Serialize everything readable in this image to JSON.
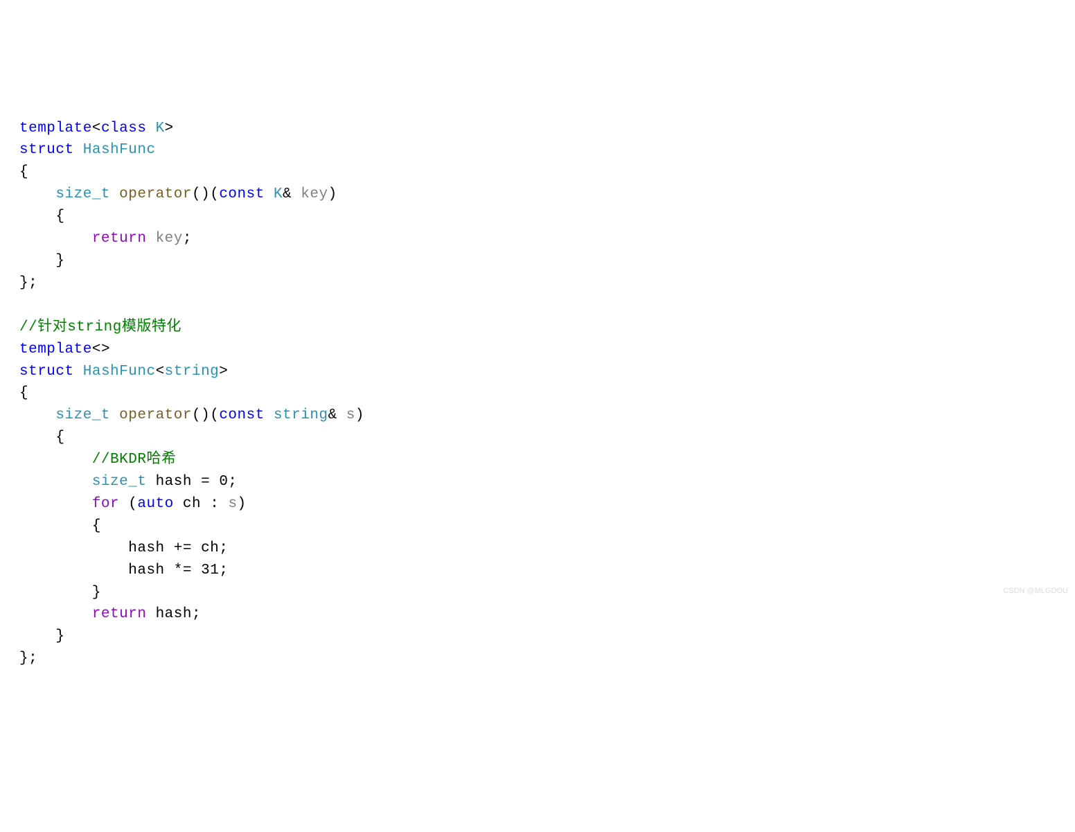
{
  "code": {
    "l1": {
      "template": "template",
      "lt": "<",
      "class_kw": "class",
      "sp": " ",
      "K": "K",
      "gt": ">"
    },
    "l2": {
      "struct": "struct",
      "sp": " ",
      "HashFunc": "HashFunc"
    },
    "l3": {
      "brace": "{"
    },
    "l4": {
      "size_t": "size_t",
      "sp": " ",
      "operator": "operator",
      "parens": "()",
      "open": "(",
      "const": "const",
      "sp2": " ",
      "K": "K",
      "amp": "&",
      "sp3": " ",
      "key": "key",
      "close": ")"
    },
    "l5": {
      "brace": "{"
    },
    "l6": {
      "return": "return",
      "sp": " ",
      "key": "key",
      "semi": ";"
    },
    "l7": {
      "brace": "}"
    },
    "l8": {
      "brace": "};"
    },
    "l9": {
      "blank": ""
    },
    "l10": {
      "cmt": "//针对string模版特化"
    },
    "l11": {
      "template": "template",
      "lt": "<",
      "gt": ">"
    },
    "l12": {
      "struct": "struct",
      "sp": " ",
      "HashFunc": "HashFunc",
      "lt": "<",
      "string": "string",
      "gt": ">"
    },
    "l13": {
      "brace": "{"
    },
    "l14": {
      "size_t": "size_t",
      "sp": " ",
      "operator": "operator",
      "parens": "()",
      "open": "(",
      "const": "const",
      "sp2": " ",
      "string": "string",
      "amp": "&",
      "sp3": " ",
      "s": "s",
      "close": ")"
    },
    "l15": {
      "brace": "{"
    },
    "l16": {
      "cmt": "//BKDR哈希"
    },
    "l17": {
      "size_t": "size_t",
      "sp": " ",
      "hash": "hash",
      "sp2": " ",
      "eq": "=",
      "sp3": " ",
      "zero": "0",
      "semi": ";"
    },
    "l18": {
      "for": "for",
      "sp": " ",
      "open": "(",
      "auto": "auto",
      "sp2": " ",
      "ch": "ch",
      "sp3": " ",
      "colon": ":",
      "sp4": " ",
      "s": "s",
      "close": ")"
    },
    "l19": {
      "brace": "{"
    },
    "l20": {
      "hash": "hash",
      "sp": " ",
      "pluseq": "+=",
      "sp2": " ",
      "ch": "ch",
      "semi": ";"
    },
    "l21": {
      "hash": "hash",
      "sp": " ",
      "stareq": "*=",
      "sp2": " ",
      "n31": "31",
      "semi": ";"
    },
    "l22": {
      "brace": "}"
    },
    "l23": {
      "return": "return",
      "sp": " ",
      "hash": "hash",
      "semi": ";"
    },
    "l24": {
      "brace": "}"
    },
    "l25": {
      "brace": "};"
    }
  },
  "watermark": "CSDN @MLGDOU"
}
